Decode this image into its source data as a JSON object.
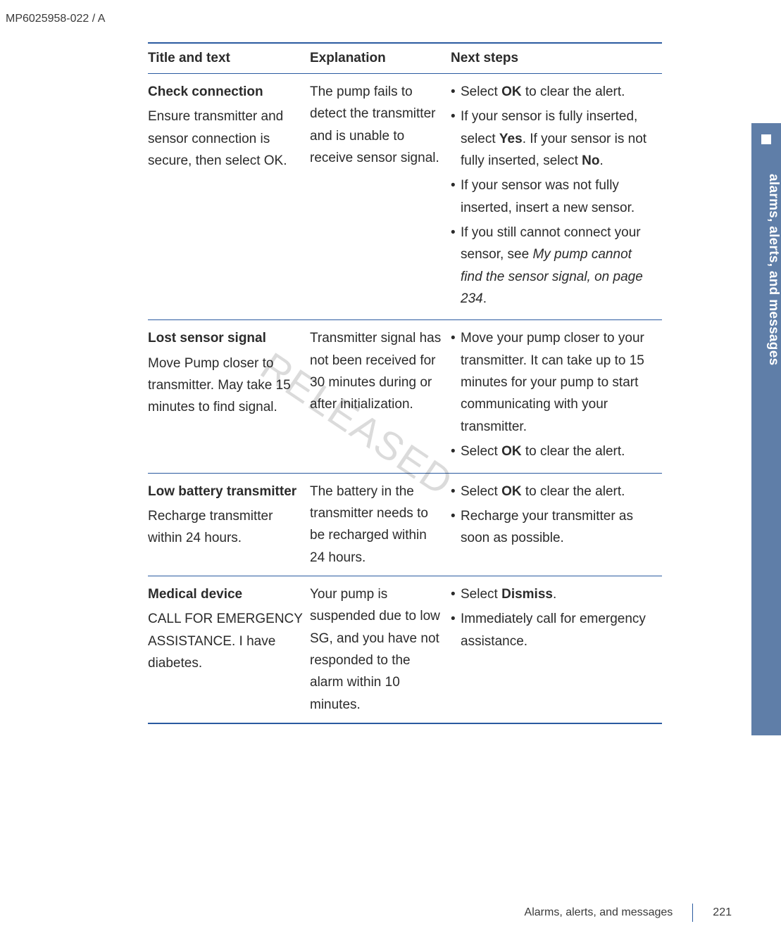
{
  "header_code": "MP6025958-022 / A",
  "watermark": "RELEASED",
  "side_tab": {
    "label": "alarms, alerts, and messages"
  },
  "footer": {
    "section": "Alarms, alerts, and messages",
    "page": "221"
  },
  "table": {
    "headers": [
      "Title and text",
      "Explanation",
      "Next steps"
    ],
    "rows": [
      {
        "title": "Check connection",
        "subtitle": "Ensure transmitter and sensor connection is secure, then select OK.",
        "explanation": "The pump fails to detect the transmitter and is unable to receive sensor signal.",
        "steps": [
          [
            {
              "t": "Select "
            },
            {
              "t": "OK",
              "b": true
            },
            {
              "t": " to clear the alert."
            }
          ],
          [
            {
              "t": "If your sensor is fully inserted, select "
            },
            {
              "t": "Yes",
              "b": true
            },
            {
              "t": ". If your sensor is not fully inserted, select "
            },
            {
              "t": "No",
              "b": true
            },
            {
              "t": "."
            }
          ],
          [
            {
              "t": "If your sensor was not fully inserted, insert a new sensor."
            }
          ],
          [
            {
              "t": "If you still cannot connect your sensor, see "
            },
            {
              "t": "My pump cannot find the sensor signal, on page 234",
              "i": true
            },
            {
              "t": "."
            }
          ]
        ]
      },
      {
        "title": "Lost sensor signal",
        "subtitle": "Move Pump closer to transmitter. May take 15 minutes to find signal.",
        "explanation": "Transmitter signal has not been received for 30 minutes during or after initialization.",
        "steps": [
          [
            {
              "t": "Move your pump closer to your transmitter. It can take up to 15 minutes for your pump to start communicating with your transmitter."
            }
          ],
          [
            {
              "t": "Select "
            },
            {
              "t": "OK",
              "b": true
            },
            {
              "t": " to clear the alert."
            }
          ]
        ]
      },
      {
        "title": "Low battery transmitter",
        "subtitle": "Recharge transmitter within 24 hours.",
        "explanation": "The battery in the transmitter needs to be recharged within 24 hours.",
        "steps": [
          [
            {
              "t": "Select "
            },
            {
              "t": "OK",
              "b": true
            },
            {
              "t": " to clear the alert."
            }
          ],
          [
            {
              "t": "Recharge your transmitter as soon as possible."
            }
          ]
        ]
      },
      {
        "title": "Medical device",
        "subtitle": "CALL FOR EMERGENCY ASSISTANCE. I have diabetes.",
        "explanation": "Your pump is suspended due to low SG, and you have not responded to the alarm within 10 minutes.",
        "steps": [
          [
            {
              "t": "Select "
            },
            {
              "t": "Dismiss",
              "b": true
            },
            {
              "t": "."
            }
          ],
          [
            {
              "t": "Immediately call for emergency assistance."
            }
          ]
        ]
      }
    ]
  }
}
